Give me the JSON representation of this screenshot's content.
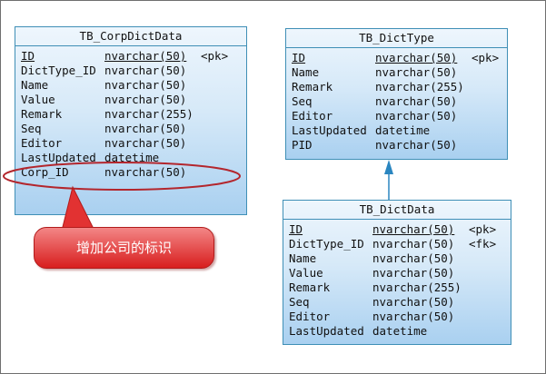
{
  "entities": {
    "corp_dict_data": {
      "title": "TB_CorpDictData",
      "columns": [
        {
          "name": "ID",
          "type": "nvarchar(50)",
          "key": "<pk>"
        },
        {
          "name": "DictType_ID",
          "type": "nvarchar(50)",
          "key": ""
        },
        {
          "name": "Name",
          "type": "nvarchar(50)",
          "key": ""
        },
        {
          "name": "Value",
          "type": "nvarchar(50)",
          "key": ""
        },
        {
          "name": "Remark",
          "type": "nvarchar(255)",
          "key": ""
        },
        {
          "name": "Seq",
          "type": "nvarchar(50)",
          "key": ""
        },
        {
          "name": "Editor",
          "type": "nvarchar(50)",
          "key": ""
        },
        {
          "name": "LastUpdated",
          "type": "datetime",
          "key": ""
        },
        {
          "name": "Corp_ID",
          "type": "nvarchar(50)",
          "key": ""
        }
      ]
    },
    "dict_type": {
      "title": "TB_DictType",
      "columns": [
        {
          "name": "ID",
          "type": "nvarchar(50)",
          "key": "<pk>"
        },
        {
          "name": "Name",
          "type": "nvarchar(50)",
          "key": ""
        },
        {
          "name": "Remark",
          "type": "nvarchar(255)",
          "key": ""
        },
        {
          "name": "Seq",
          "type": "nvarchar(50)",
          "key": ""
        },
        {
          "name": "Editor",
          "type": "nvarchar(50)",
          "key": ""
        },
        {
          "name": "LastUpdated",
          "type": "datetime",
          "key": ""
        },
        {
          "name": "PID",
          "type": "nvarchar(50)",
          "key": ""
        }
      ]
    },
    "dict_data": {
      "title": "TB_DictData",
      "columns": [
        {
          "name": "ID",
          "type": "nvarchar(50)",
          "key": "<pk>"
        },
        {
          "name": "DictType_ID",
          "type": "nvarchar(50)",
          "key": "<fk>"
        },
        {
          "name": "Name",
          "type": "nvarchar(50)",
          "key": ""
        },
        {
          "name": "Value",
          "type": "nvarchar(50)",
          "key": ""
        },
        {
          "name": "Remark",
          "type": "nvarchar(255)",
          "key": ""
        },
        {
          "name": "Seq",
          "type": "nvarchar(50)",
          "key": ""
        },
        {
          "name": "Editor",
          "type": "nvarchar(50)",
          "key": ""
        },
        {
          "name": "LastUpdated",
          "type": "datetime",
          "key": ""
        }
      ]
    }
  },
  "callout": {
    "text": "增加公司的标识"
  },
  "colors": {
    "entity_border": "#3f8fb6",
    "entity_fill_top": "#eef6fd",
    "entity_fill_bottom": "#a9d0f0",
    "connector": "#2a86c0",
    "highlight": "#b3262d",
    "callout_fill": "#d81e1e"
  }
}
